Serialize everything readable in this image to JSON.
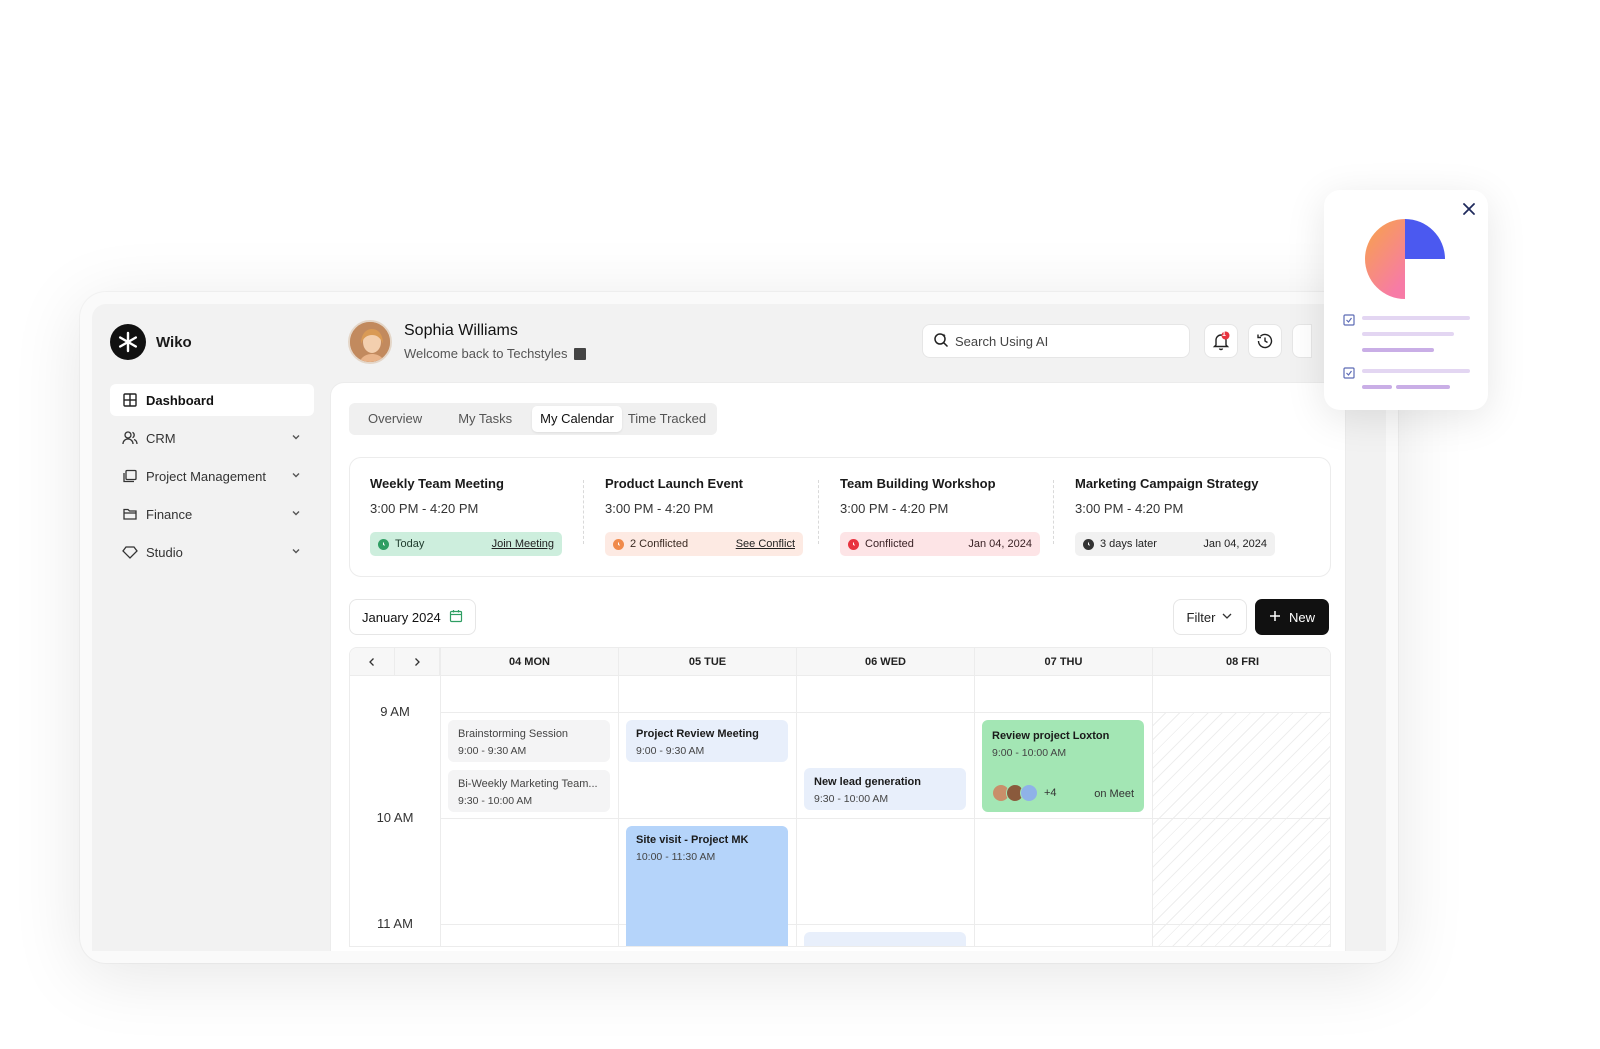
{
  "app": {
    "name": "Wiko"
  },
  "sidebar": {
    "items": [
      {
        "label": "Dashboard",
        "icon": "grid-icon",
        "active": true
      },
      {
        "label": "CRM",
        "icon": "users-icon"
      },
      {
        "label": "Project Management",
        "icon": "folders-icon"
      },
      {
        "label": "Finance",
        "icon": "folder-icon"
      },
      {
        "label": "Studio",
        "icon": "diamond-icon"
      }
    ]
  },
  "header": {
    "user_name": "Sophia Williams",
    "welcome": "Welcome back to Techstyles",
    "search_placeholder": "Search Using AI",
    "notification_count": "1"
  },
  "tabs": [
    "Overview",
    "My Tasks",
    "My Calendar",
    "Time Tracked"
  ],
  "active_tab": "My Calendar",
  "events": [
    {
      "title": "Weekly Team Meeting",
      "time": "3:00 PM - 4:20 PM",
      "status": "Today",
      "action": "Join Meeting",
      "color": "#2f9e63"
    },
    {
      "title": "Product Launch Event",
      "time": "3:00 PM - 4:20 PM",
      "status": "2 Conflicted",
      "action": "See Conflict",
      "color": "#f08a4b"
    },
    {
      "title": "Team Building Workshop",
      "time": "3:00 PM - 4:20 PM",
      "status": "Conflicted",
      "date": "Jan 04, 2024",
      "color": "#e8333f"
    },
    {
      "title": "Marketing Campaign Strategy",
      "time": "3:00 PM - 4:20 PM",
      "status": "3 days later",
      "date": "Jan 04, 2024",
      "color": "#333333"
    }
  ],
  "calendar": {
    "month": "January 2024",
    "filter_label": "Filter",
    "new_label": "New",
    "days": [
      "04 MON",
      "05 TUE",
      "06 WED",
      "07 THU",
      "08 FRI"
    ],
    "times": [
      "9 AM",
      "10 AM",
      "11 AM"
    ],
    "entries": [
      {
        "title": "Brainstorming Session",
        "time": "9:00 - 9:30 AM"
      },
      {
        "title": "Bi-Weekly Marketing Team...",
        "time": "9:30 - 10:00 AM"
      },
      {
        "title": "Project Review Meeting",
        "time": "9:00 - 9:30 AM"
      },
      {
        "title": "Site visit - Project MK",
        "time": "10:00 - 11:30 AM"
      },
      {
        "title": "New lead generation",
        "time": "9:30 - 10:00 AM"
      },
      {
        "title": "Review project Loxton",
        "time": "9:00 - 10:00 AM",
        "extra_attendees": "+4",
        "location": "on Meet"
      }
    ]
  },
  "colors": {
    "accent_dark": "#111111",
    "widget_orange": "#f7a447",
    "widget_pink": "#f77ba6",
    "widget_blue": "#4b59f0",
    "widget_lines": "#c9aee6"
  }
}
